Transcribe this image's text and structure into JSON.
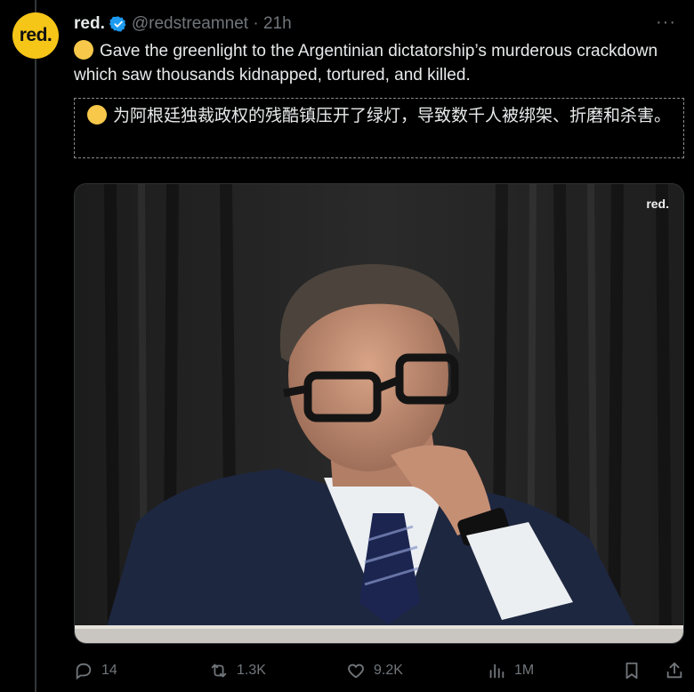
{
  "post": {
    "avatar_text": "red.",
    "display_name": "red.",
    "handle_time": "@redstreamnet · 21h",
    "more_label": "···",
    "body": "Gave the greenlight to the Argentinian dictatorship’s murderous crackdown which saw thousands kidnapped, tortured, and killed.",
    "translation": "为阿根廷独裁政权的残酷镇压开了绿灯，导致数千人被绑架、折磨和杀害。",
    "media_watermark": "red."
  },
  "actions": {
    "replies": "14",
    "reposts": "1.3K",
    "likes": "9.2K",
    "views": "1M"
  },
  "colors": {
    "background": "#000000",
    "text": "#e7e9ea",
    "muted": "#71767b",
    "verified": "#1d9bf0",
    "avatar": "#f5c518"
  },
  "icons": {
    "reply": "reply-icon",
    "repost": "repost-icon",
    "like": "heart-icon",
    "views": "views-icon",
    "bookmark": "bookmark-icon",
    "share": "share-icon",
    "verified": "verified-badge-icon"
  }
}
